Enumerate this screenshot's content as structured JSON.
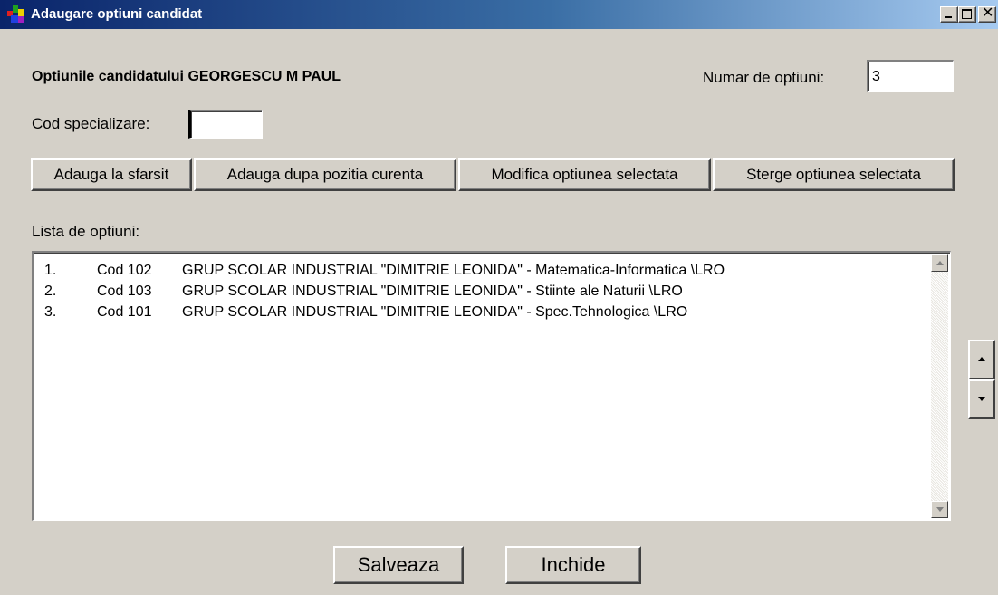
{
  "window": {
    "title": "Adaugare optiuni candidat",
    "minimize_glyph": "_",
    "maximize_glyph": "□",
    "close_glyph": "×"
  },
  "header": {
    "candidate_label": "Optiunile candidatului GEORGESCU M PAUL",
    "count_label": "Numar de optiuni:",
    "count_value": "3"
  },
  "form": {
    "code_label": "Cod specializare:",
    "code_value": ""
  },
  "toolbar": {
    "add_end": "Adauga la sfarsit",
    "add_after": "Adauga dupa pozitia curenta",
    "modify": "Modifica optiunea selectata",
    "delete": "Sterge optiunea selectata"
  },
  "list": {
    "label": "Lista de optiuni:",
    "items": [
      {
        "index": "1.",
        "code": "Cod 102",
        "description": "GRUP SCOLAR INDUSTRIAL \"DIMITRIE LEONIDA\" - Matematica-Informatica \\LRO"
      },
      {
        "index": "2.",
        "code": "Cod 103",
        "description": "GRUP SCOLAR INDUSTRIAL \"DIMITRIE LEONIDA\" - Stiinte ale Naturii \\LRO"
      },
      {
        "index": "3.",
        "code": "Cod 101",
        "description": "GRUP SCOLAR INDUSTRIAL \"DIMITRIE LEONIDA\" - Spec.Tehnologica \\LRO"
      }
    ]
  },
  "footer": {
    "save": "Salveaza",
    "close": "Inchide"
  },
  "icons": {
    "app": "app-icon",
    "move_up": "arrow-up-icon",
    "move_down": "arrow-down-icon"
  },
  "colors": {
    "titlebar_start": "#0a246a",
    "titlebar_end": "#a6caf0",
    "face": "#d4d0c8"
  }
}
